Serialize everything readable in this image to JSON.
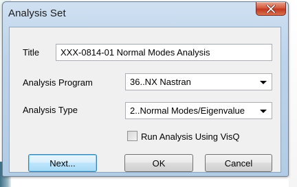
{
  "window": {
    "title": "Analysis Set"
  },
  "form": {
    "title_label": "Title",
    "title_value": "XXX-0814-01 Normal Modes Analysis",
    "program_label": "Analysis Program",
    "program_value": "36..NX Nastran",
    "type_label": "Analysis Type",
    "type_value": "2..Normal Modes/Eigenvalue",
    "visq_label": "Run Analysis Using VisQ",
    "visq_checked": false
  },
  "buttons": {
    "next": "Next...",
    "ok": "OK",
    "cancel": "Cancel"
  },
  "icons": {
    "close": "close-icon",
    "dropdown": "chevron-down-icon"
  }
}
